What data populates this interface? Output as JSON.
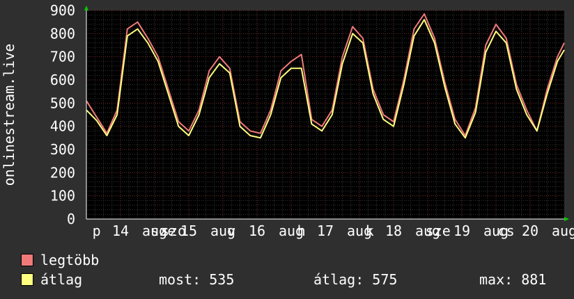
{
  "chart_data": {
    "type": "line",
    "ylabel": "onlinestream.live",
    "ylim": [
      0,
      900
    ],
    "yticks": [
      0,
      100,
      200,
      300,
      400,
      500,
      600,
      700,
      800,
      900
    ],
    "xticks": [
      {
        "label": "p",
        "t": 0.3
      },
      {
        "label": "14",
        "t": 1.0
      },
      {
        "label": "aug",
        "t": 2.0
      },
      {
        "label": "sze",
        "t": 2.25
      },
      {
        "label": "szo",
        "t": 2.55
      },
      {
        "label": "15",
        "t": 3.0
      },
      {
        "label": "aug",
        "t": 4.0
      },
      {
        "label": "v",
        "t": 4.25
      },
      {
        "label": "16",
        "t": 5.0
      },
      {
        "label": "aug",
        "t": 6.0
      },
      {
        "label": "h",
        "t": 6.3
      },
      {
        "label": "17",
        "t": 7.0
      },
      {
        "label": "aug",
        "t": 8.0
      },
      {
        "label": "k",
        "t": 8.3
      },
      {
        "label": "18",
        "t": 9.0
      },
      {
        "label": "aug",
        "t": 10.0
      },
      {
        "label": "sze",
        "t": 10.3
      },
      {
        "label": "19",
        "t": 11.0
      },
      {
        "label": "aug",
        "t": 12.0
      },
      {
        "label": "cs",
        "t": 12.3
      },
      {
        "label": "20",
        "t": 13.0
      },
      {
        "label": "aug",
        "t": 14.0
      }
    ],
    "grid": true,
    "series": [
      {
        "name": "legtöbb",
        "color": "#f07a7a",
        "x": [
          0,
          0.3,
          0.6,
          0.9,
          1.2,
          1.5,
          1.8,
          2.1,
          2.4,
          2.7,
          3.0,
          3.3,
          3.6,
          3.9,
          4.2,
          4.5,
          4.8,
          5.1,
          5.4,
          5.7,
          6.0,
          6.3,
          6.6,
          6.9,
          7.2,
          7.5,
          7.8,
          8.1,
          8.4,
          8.7,
          9.0,
          9.3,
          9.6,
          9.9,
          10.2,
          10.5,
          10.8,
          11.1,
          11.4,
          11.7,
          12.0,
          12.3,
          12.6,
          12.9,
          13.2,
          13.5,
          13.8,
          14.0
        ],
        "y": [
          510,
          440,
          370,
          470,
          820,
          850,
          780,
          700,
          560,
          420,
          380,
          470,
          640,
          700,
          650,
          420,
          380,
          370,
          470,
          640,
          680,
          710,
          430,
          400,
          470,
          700,
          830,
          780,
          560,
          450,
          420,
          600,
          820,
          885,
          780,
          590,
          430,
          360,
          480,
          750,
          840,
          780,
          580,
          470,
          380,
          560,
          700,
          760
        ]
      },
      {
        "name": "átlag",
        "color": "#ffff80",
        "x": [
          0,
          0.3,
          0.6,
          0.9,
          1.2,
          1.5,
          1.8,
          2.1,
          2.4,
          2.7,
          3.0,
          3.3,
          3.6,
          3.9,
          4.2,
          4.5,
          4.8,
          5.1,
          5.4,
          5.7,
          6.0,
          6.3,
          6.6,
          6.9,
          7.2,
          7.5,
          7.8,
          8.1,
          8.4,
          8.7,
          9.0,
          9.3,
          9.6,
          9.9,
          10.2,
          10.5,
          10.8,
          11.1,
          11.4,
          11.7,
          12.0,
          12.3,
          12.6,
          12.9,
          13.2,
          13.5,
          13.8,
          14.0
        ],
        "y": [
          470,
          425,
          360,
          450,
          790,
          820,
          760,
          680,
          540,
          400,
          360,
          450,
          610,
          670,
          630,
          400,
          360,
          350,
          450,
          610,
          650,
          650,
          410,
          380,
          450,
          670,
          800,
          760,
          540,
          430,
          400,
          580,
          790,
          860,
          760,
          570,
          410,
          350,
          460,
          720,
          810,
          760,
          560,
          450,
          380,
          540,
          680,
          730
        ]
      }
    ]
  },
  "legend": {
    "max_label": "legtöbb",
    "avg_label": "átlag",
    "max_color": "#f07a7a",
    "avg_color": "#ffff80",
    "current": "most: 535",
    "average": "átlag: 575",
    "maximum": "max: 881"
  }
}
